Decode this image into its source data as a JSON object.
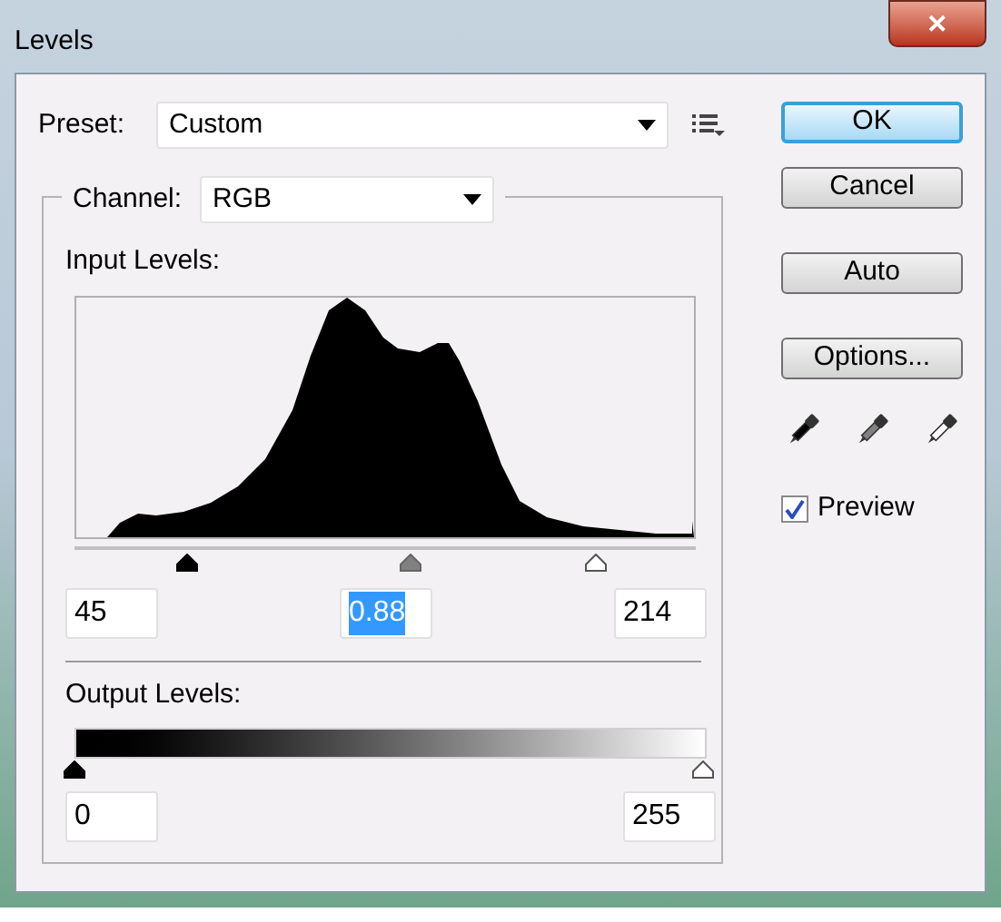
{
  "window": {
    "title": "Levels",
    "close": "✕"
  },
  "preset": {
    "label": "Preset:",
    "value": "Custom"
  },
  "channel": {
    "label": "Channel:",
    "value": "RGB"
  },
  "input_levels": {
    "label": "Input Levels:",
    "fields": [
      {
        "value": "45",
        "kind": "black",
        "level": 0.18,
        "selected": false
      },
      {
        "value": "0.88",
        "kind": "gray",
        "level": 0.54,
        "selected": true
      },
      {
        "value": "214",
        "kind": "white",
        "level": 0.84,
        "selected": false
      }
    ]
  },
  "output_levels": {
    "label": "Output Levels:",
    "fields": [
      {
        "value": "0",
        "kind": "black",
        "level": 0
      },
      {
        "value": "255",
        "kind": "white",
        "level": 1
      }
    ]
  },
  "buttons": [
    {
      "label": "OK",
      "selected": true
    },
    {
      "label": "Cancel",
      "selected": false
    },
    {
      "label": "Auto",
      "selected": false
    },
    {
      "label": "Options...",
      "selected": false
    }
  ],
  "eyedroppers": [
    {
      "kind": "black"
    },
    {
      "kind": "gray"
    },
    {
      "kind": "white"
    }
  ],
  "preview": {
    "label": "Preview",
    "checked": true
  }
}
